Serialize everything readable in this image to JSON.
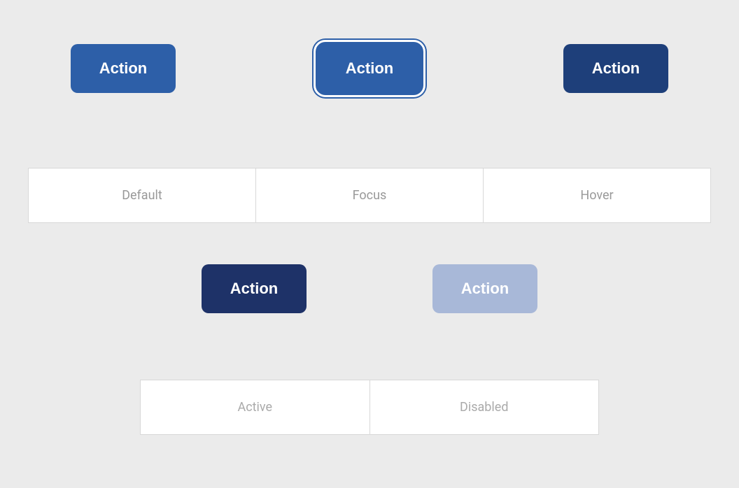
{
  "buttons": {
    "row1": {
      "default": {
        "label": "Action",
        "state": "default"
      },
      "focus": {
        "label": "Action",
        "state": "focus"
      },
      "hover": {
        "label": "Action",
        "state": "hover"
      }
    },
    "row2": {
      "active": {
        "label": "Action",
        "state": "active"
      },
      "disabled": {
        "label": "Action",
        "state": "disabled"
      }
    }
  },
  "labels": {
    "row1": [
      "Default",
      "Focus",
      "Hover"
    ],
    "row2": [
      "Active",
      "Disabled"
    ]
  },
  "colors": {
    "bg": "#ebebeb",
    "btn_default": "#2d5fa8",
    "btn_hover": "#1e3f7a",
    "btn_active": "#1e3268",
    "btn_disabled": "#a8b8d8",
    "text_white": "#ffffff",
    "label_text": "#aaaaaa"
  }
}
